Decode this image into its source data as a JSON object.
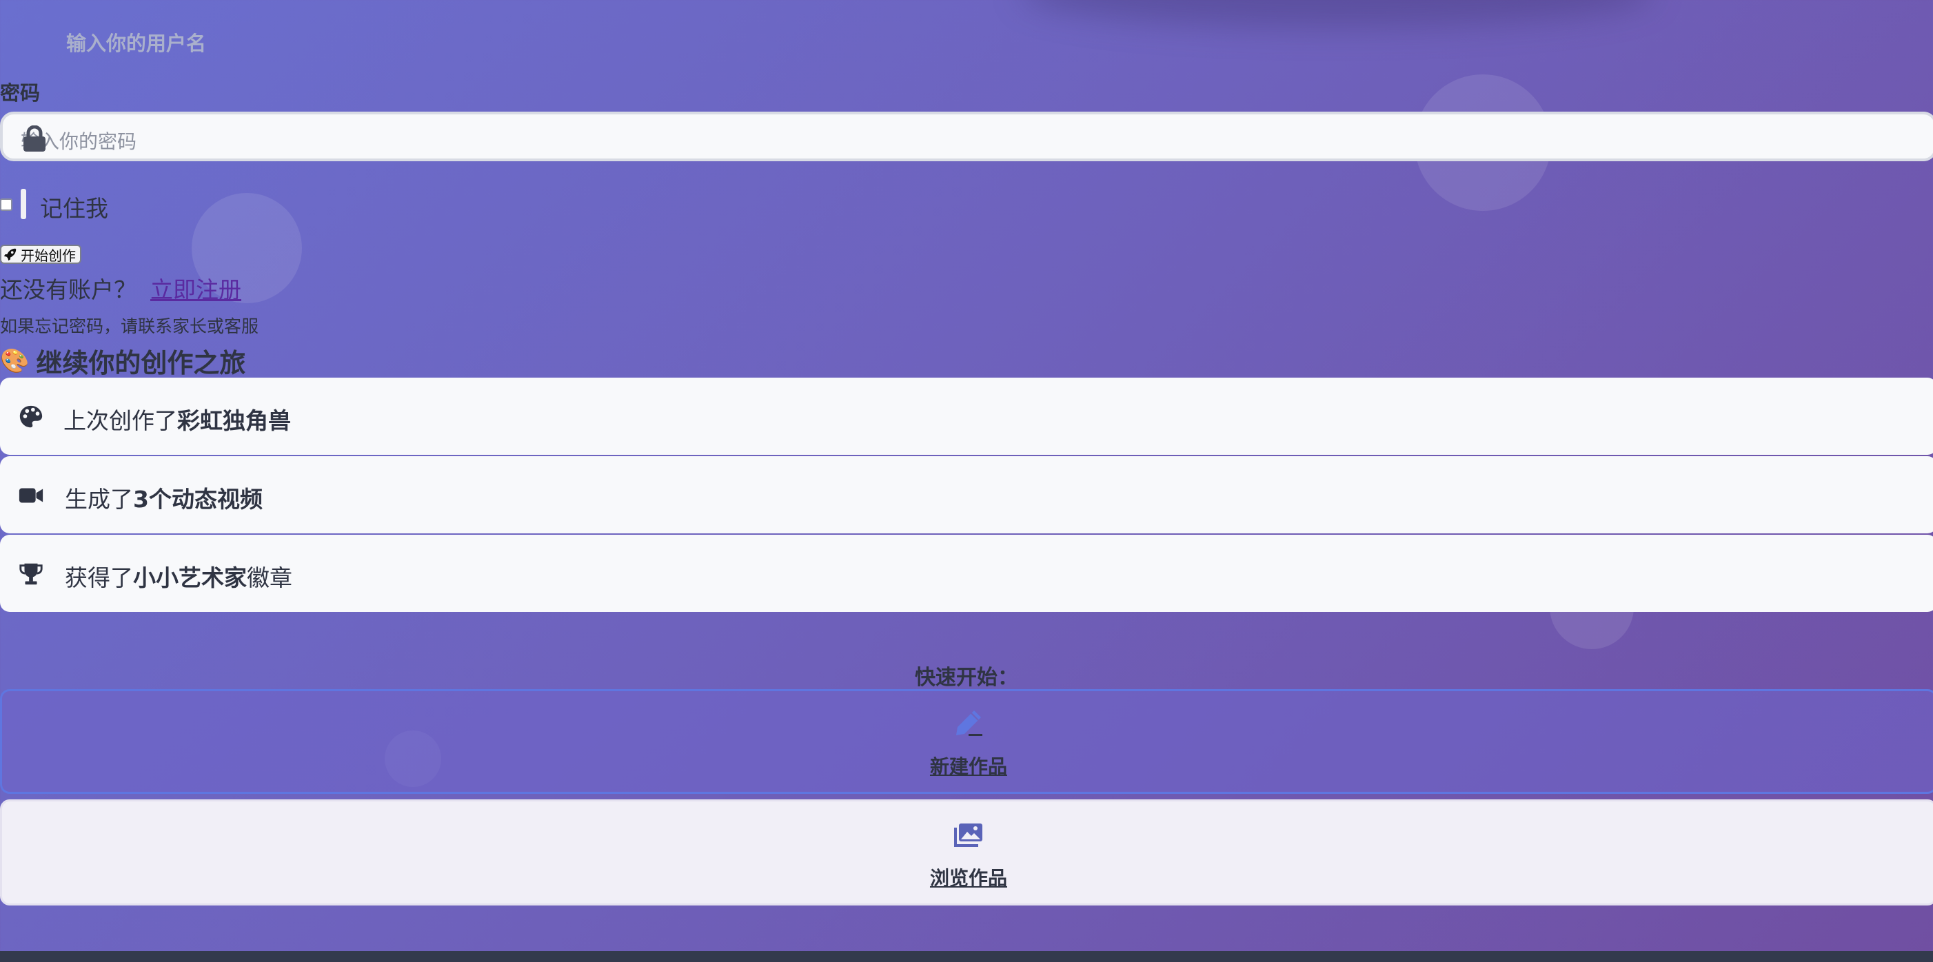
{
  "login": {
    "username_placeholder": "输入你的用户名",
    "password_label": "密码",
    "password_placeholder": "输入你的密码",
    "remember_label": "记住我",
    "submit_label": "开始创作",
    "no_account_text": "还没有账户？",
    "register_link": "立即注册",
    "forgot_hint": "如果忘记密码，请联系家长或客服"
  },
  "continue": {
    "emoji": "🎨",
    "title": "继续你的创作之旅",
    "items": [
      {
        "icon": "palette-icon",
        "prefix": "上次创作了",
        "highlight": "彩虹独角兽",
        "suffix": ""
      },
      {
        "icon": "video-icon",
        "prefix": "生成了",
        "highlight": "3个动态视频",
        "suffix": ""
      },
      {
        "icon": "trophy-icon",
        "prefix": "获得了",
        "highlight": "小小艺术家",
        "suffix": "徽章"
      }
    ]
  },
  "quick_start": {
    "title": "快速开始：",
    "actions": [
      {
        "icon": "pencil-icon",
        "label": "新建作品"
      },
      {
        "icon": "images-icon",
        "label": "浏览作品"
      }
    ]
  },
  "colors": {
    "bg_start": "#6a6fcf",
    "bg_end": "#704fa2",
    "link": "#5a2aa0",
    "accent_blue": "#5f76e0",
    "text_dark": "#2f3443"
  }
}
